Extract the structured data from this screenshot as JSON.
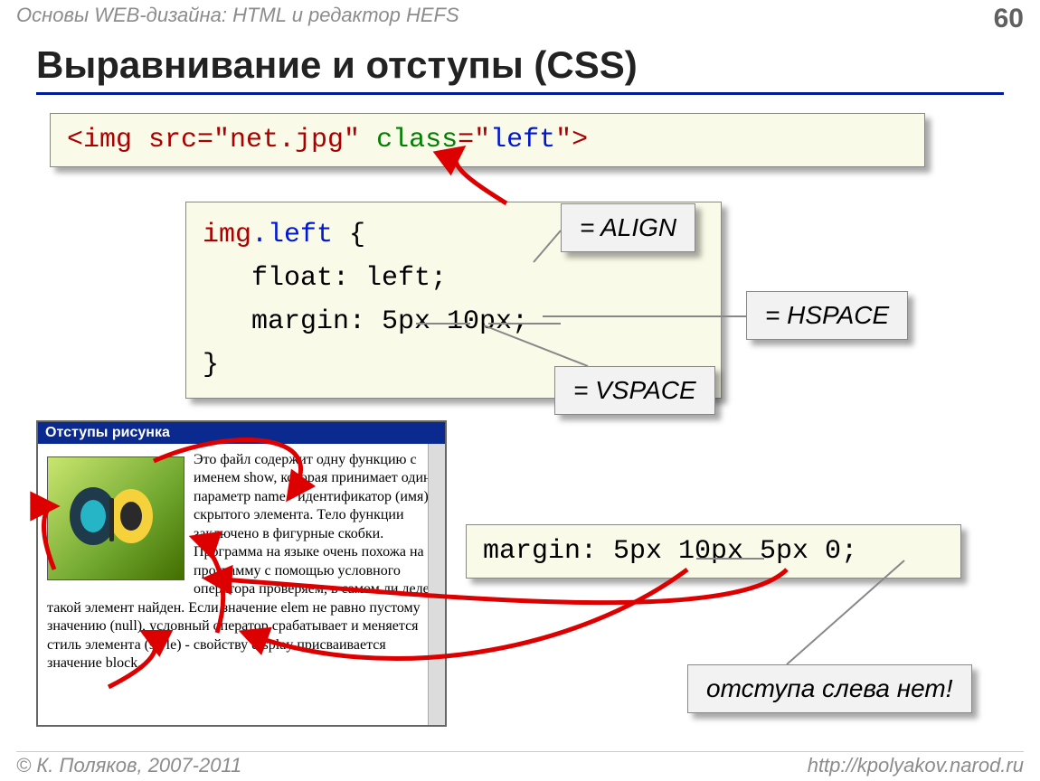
{
  "header": {
    "left": "Основы WEB-дизайна: HTML и редактор HEFS",
    "page": "60"
  },
  "title": "Выравнивание и отступы (CSS)",
  "code1": {
    "p1": "<img src=\"net.jpg\" ",
    "p2": "class",
    "p3": "=\"",
    "p4": "left",
    "p5": "\">"
  },
  "code2": {
    "l1a": "img",
    "l1b": ".left",
    "l1c": " {",
    "l2": "   float: left;",
    "l3": "   margin: 5px 10px;",
    "l4": "}"
  },
  "code3": "margin: 5px 10px 5px 0;",
  "callouts": {
    "align": "= ALIGN",
    "hspace": "= HSPACE",
    "vspace": "= VSPACE",
    "noleft": "отступа слева нет!"
  },
  "window": {
    "title": "Отступы рисунка",
    "text": "Это файл содержит одну функцию с именем show, которая принимает один параметр name - идентификатор (имя) скрытого элемента. Тело функции заключено в фигурные скобки. Программа на языке очень похожа на программу с помощью условного оператора проверяем, в самом ли деле такой элемент найден. Если значение elem не равно пустому значению (null), условный оператор срабатывает и меняется стиль элемента (style) - свойству display присваивается значение block."
  },
  "footer": {
    "left": "© К. Поляков, 2007-2011",
    "right": "http://kpolyakov.narod.ru"
  }
}
